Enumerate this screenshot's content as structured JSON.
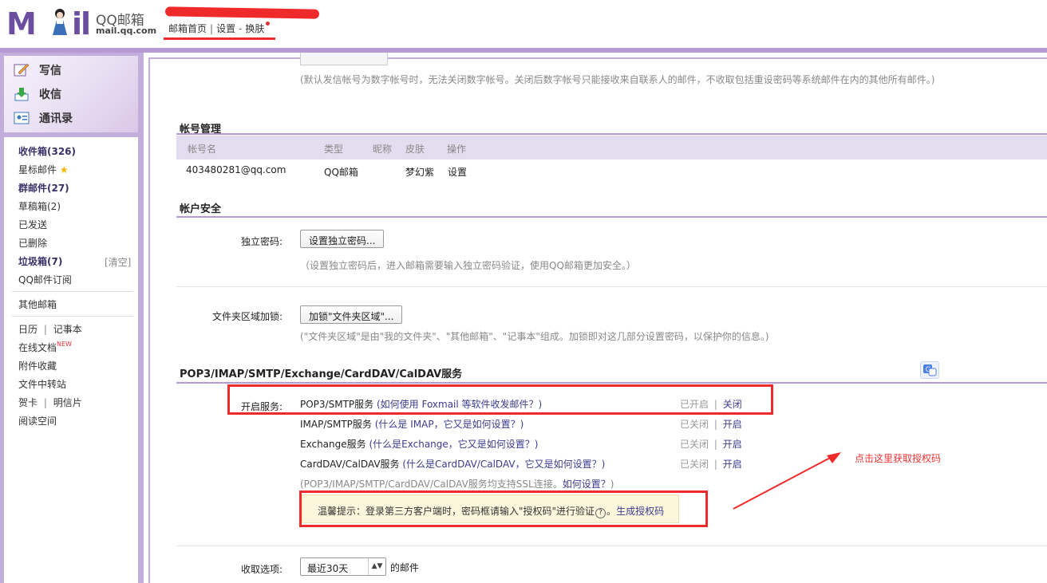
{
  "header": {
    "brand": "QQ邮箱",
    "url": "mail.qq.com",
    "links": [
      "邮箱首页",
      "设置",
      "换肤"
    ],
    "sep": "|",
    "dash": "-"
  },
  "sidebar": {
    "actions": [
      "写信",
      "收信",
      "通讯录"
    ],
    "items": [
      {
        "label": "收件箱(326)"
      },
      {
        "label": "星标邮件"
      },
      {
        "label": "群邮件(27)"
      },
      {
        "label": "草稿箱(2)"
      },
      {
        "label": "已发送"
      },
      {
        "label": "已删除"
      },
      {
        "label": "垃圾箱(7)"
      },
      {
        "label": "QQ邮件订阅"
      },
      {
        "label": "其他邮箱"
      },
      {
        "label": "日历"
      },
      {
        "label": "记事本"
      },
      {
        "label": "在线文档"
      },
      {
        "label": "附件收藏"
      },
      {
        "label": "文件中转站"
      },
      {
        "label": "贺卡"
      },
      {
        "label": "明信片"
      },
      {
        "label": "阅读空间"
      }
    ],
    "clear_label": "[清空]",
    "new_badge": "NEW",
    "star": "★",
    "sep": "|"
  },
  "main": {
    "digit_note": "(默认发信帐号为数字帐号时，无法关闭数字帐号。关闭后数字帐号只能接收来自联系人的邮件，不收取包括重设密码等系统邮件在内的其他所有邮件。)",
    "account": {
      "title": "帐号管理",
      "columns": [
        "帐号名",
        "类型",
        "昵称",
        "皮肤",
        "操作"
      ],
      "row": {
        "name": "403480281@qq.com",
        "type": "QQ邮箱",
        "nick": "",
        "skin": "梦幻紫",
        "op": "设置"
      }
    },
    "security": {
      "title": "帐户安全",
      "pwd_label": "独立密码:",
      "pwd_button": "设置独立密码...",
      "pwd_note": "（设置独立密码后，进入邮箱需要输入独立密码验证，使用QQ邮箱更加安全。）",
      "folder_label": "文件夹区域加锁:",
      "folder_button": "加锁\"文件夹区域\"...",
      "folder_note": "(\"文件夹区域\"是由\"我的文件夹\"、\"其他邮箱\"、\"记事本\"组成。加锁即对这几部分设置密码，以保护你的信息。)"
    },
    "services": {
      "title": "POP3/IMAP/SMTP/Exchange/CardDAV/CalDAV服务",
      "open_label": "开启服务:",
      "rows": [
        {
          "name": "POP3/SMTP服务",
          "help": "(如何使用 Foxmail 等软件收发邮件？)",
          "state": "已开启",
          "action": "关闭"
        },
        {
          "name": "IMAP/SMTP服务",
          "help": "(什么是 IMAP，它又是如何设置？)",
          "state": "已关闭",
          "action": "开启"
        },
        {
          "name": "Exchange服务",
          "help": "(什么是Exchange，它又是如何设置？)",
          "state": "已关闭",
          "action": "开启"
        },
        {
          "name": "CardDAV/CalDAV服务",
          "help": "(什么是CardDAV/CalDAV，它又是如何设置？)",
          "state": "已关闭",
          "action": "开启"
        }
      ],
      "ssl_note": "(POP3/IMAP/SMTP/CardDAV/CalDAV服务均支持SSL连接。",
      "ssl_link": "如何设置？",
      "ssl_close": ")",
      "tip_text": "温馨提示：登录第三方客户端时，密码框请输入\"授权码\"进行验证",
      "tip_q": "?",
      "tip_link": "生成授权码",
      "sep": "|"
    },
    "annotation": "点击这里获取授权码",
    "receive": {
      "label": "收取选项:",
      "value": "最近30天",
      "suffix": "的邮件"
    }
  },
  "colors": {
    "accent": "#b59ad4",
    "red_mark": "#ee2a2a",
    "link": "#3b3b8f"
  }
}
